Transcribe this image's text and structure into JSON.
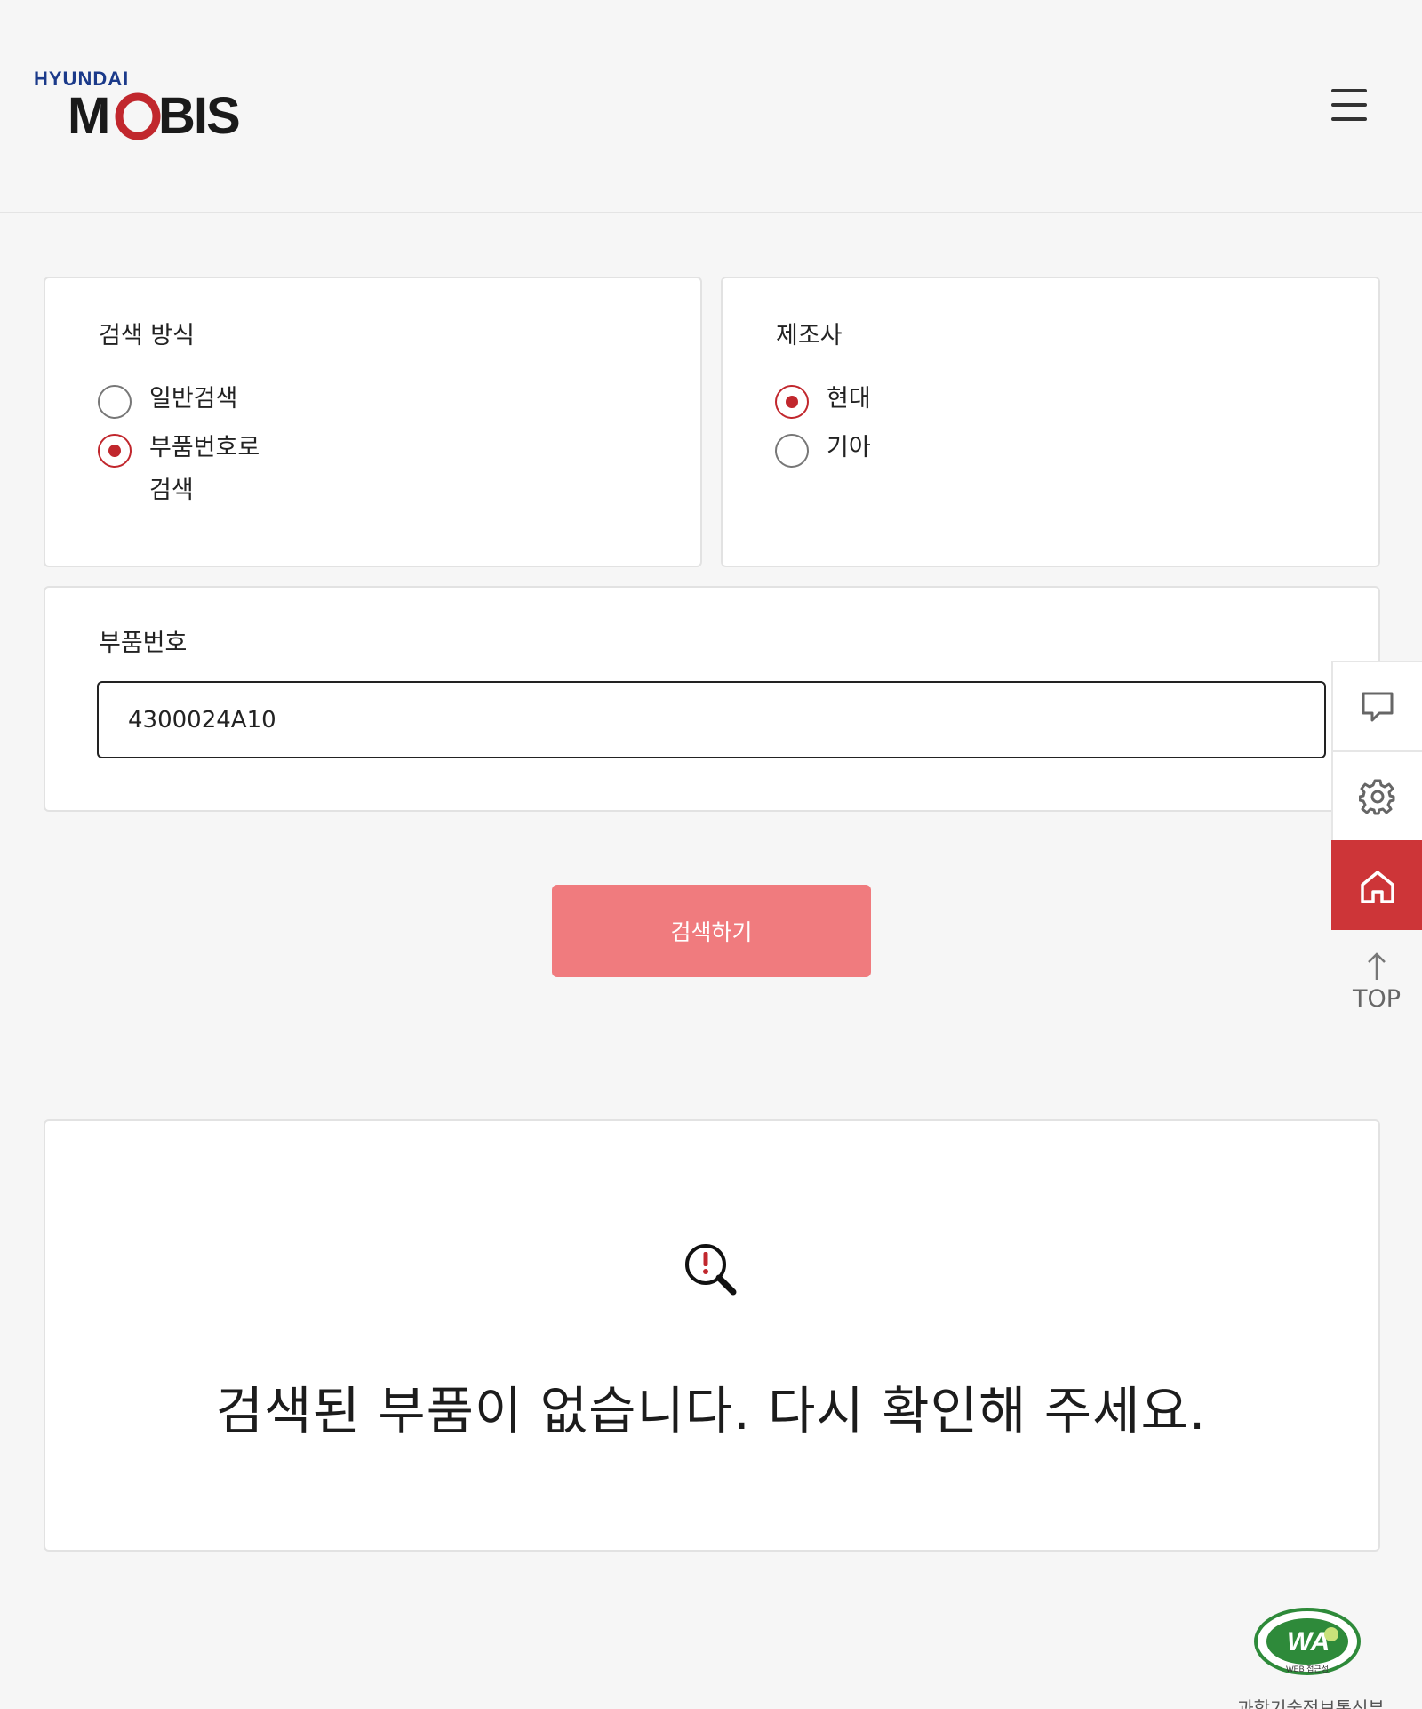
{
  "header": {
    "logo_text_top": "HYUNDAI",
    "logo_text_main": "MOBIS",
    "menu_icon": "hamburger-menu-icon"
  },
  "search_method": {
    "title": "검색 방식",
    "options": [
      {
        "label": "일반검색",
        "selected": false
      },
      {
        "label": "부품번호로 검색",
        "selected": true
      }
    ]
  },
  "manufacturer": {
    "title": "제조사",
    "options": [
      {
        "label": "현대",
        "selected": true
      },
      {
        "label": "기아",
        "selected": false
      }
    ]
  },
  "part_number": {
    "title": "부품번호",
    "value": "4300024A10"
  },
  "search_button": {
    "label": "검색하기"
  },
  "side_menu": {
    "items": [
      "chat-icon",
      "settings-icon",
      "home-icon"
    ],
    "top_label": "TOP"
  },
  "result": {
    "icon": "search-alert-icon",
    "message": "검색된 부품이 없습니다. 다시 확인해 주세요."
  },
  "footer": {
    "badge_text": "WA",
    "badge_sub": "WEB 접근성",
    "caption": "과학기술정보통신부"
  },
  "colors": {
    "accent": "#c1272d",
    "button": "#f07b7e",
    "home_button": "#cd3538",
    "background": "#f6f6f6",
    "logo_blue": "#1b3a8a"
  }
}
